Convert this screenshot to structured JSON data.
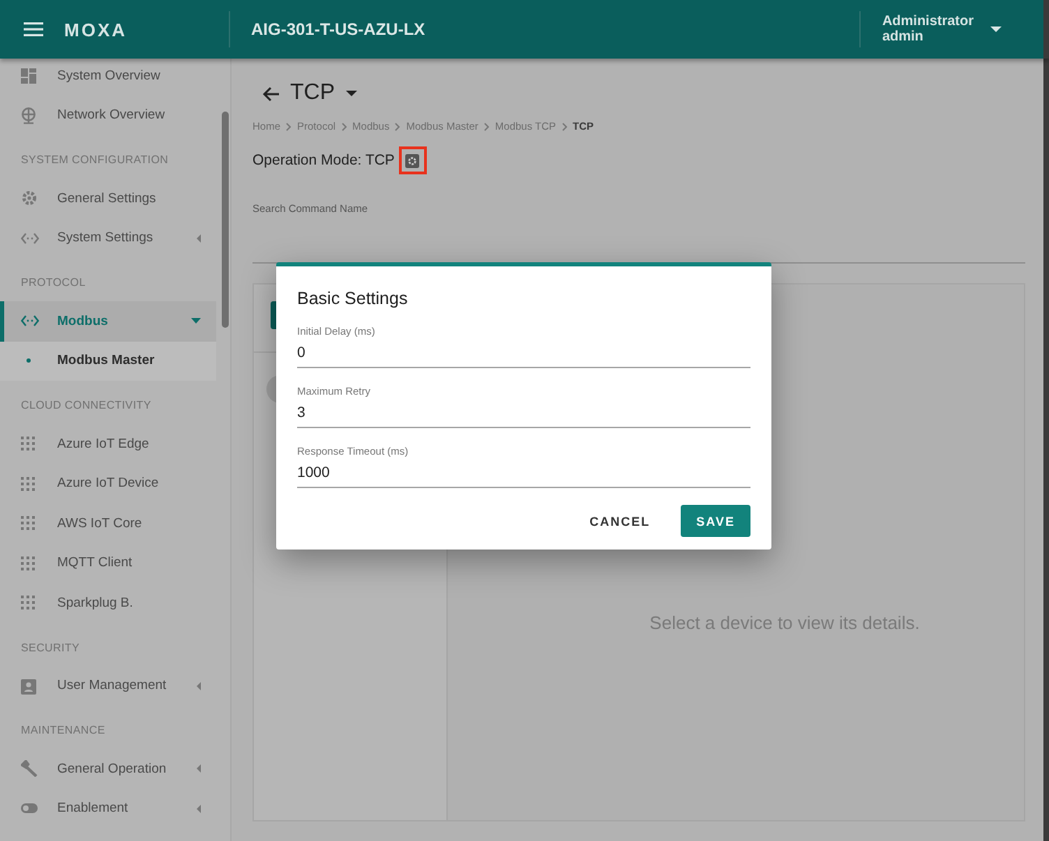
{
  "header": {
    "logo": "MOXA",
    "device": "AIG-301-T-US-AZU-LX",
    "user": {
      "role": "Administrator",
      "name": "admin"
    }
  },
  "sidebar": {
    "entries": [
      {
        "kind": "item",
        "label": "System Overview",
        "selected": false,
        "expandable": false
      },
      {
        "kind": "item",
        "label": "Network Overview",
        "selected": false,
        "expandable": false
      },
      {
        "kind": "heading",
        "label": "SYSTEM CONFIGURATION"
      },
      {
        "kind": "item",
        "label": "General Settings",
        "selected": false,
        "expandable": false
      },
      {
        "kind": "item",
        "label": "System Settings",
        "selected": false,
        "expandable": true,
        "expanded": false
      },
      {
        "kind": "heading",
        "label": "PROTOCOL"
      },
      {
        "kind": "item",
        "label": "Modbus",
        "selected": true,
        "expandable": true,
        "expanded": true,
        "children": [
          {
            "label": "Modbus Master",
            "selected": true
          }
        ]
      },
      {
        "kind": "heading",
        "label": "CLOUD CONNECTIVITY"
      },
      {
        "kind": "item",
        "label": "Azure IoT Edge",
        "selected": false,
        "expandable": false
      },
      {
        "kind": "item",
        "label": "Azure IoT Device",
        "selected": false,
        "expandable": false
      },
      {
        "kind": "item",
        "label": "AWS IoT Core",
        "selected": false,
        "expandable": false
      },
      {
        "kind": "item",
        "label": "MQTT Client",
        "selected": false,
        "expandable": false
      },
      {
        "kind": "item",
        "label": "Sparkplug B.",
        "selected": false,
        "expandable": false
      },
      {
        "kind": "heading",
        "label": "SECURITY"
      },
      {
        "kind": "item",
        "label": "User Management",
        "selected": false,
        "expandable": true,
        "expanded": false
      },
      {
        "kind": "heading",
        "label": "MAINTENANCE"
      },
      {
        "kind": "item",
        "label": "General Operation",
        "selected": false,
        "expandable": true,
        "expanded": false
      },
      {
        "kind": "item",
        "label": "Enablement",
        "selected": false,
        "expandable": true,
        "expanded": false
      }
    ]
  },
  "page": {
    "title": "TCP",
    "breadcrumbs": [
      "Home",
      "Protocol",
      "Modbus",
      "Modbus Master",
      "Modbus TCP",
      "TCP"
    ],
    "operation_mode": "Operation Mode: TCP",
    "search": {
      "placeholder": "Search Command Name"
    },
    "empty_message": "Select a device to view its details."
  },
  "dialog": {
    "title": "Basic Settings",
    "fields": [
      {
        "label": "Initial Delay (ms)",
        "value": "0"
      },
      {
        "label": "Maximum Retry",
        "value": "3"
      },
      {
        "label": "Response Timeout (ms)",
        "value": "1000"
      }
    ],
    "buttons": [
      {
        "label": "CANCEL",
        "kind": "text"
      },
      {
        "label": "SAVE",
        "kind": "primary"
      }
    ]
  }
}
